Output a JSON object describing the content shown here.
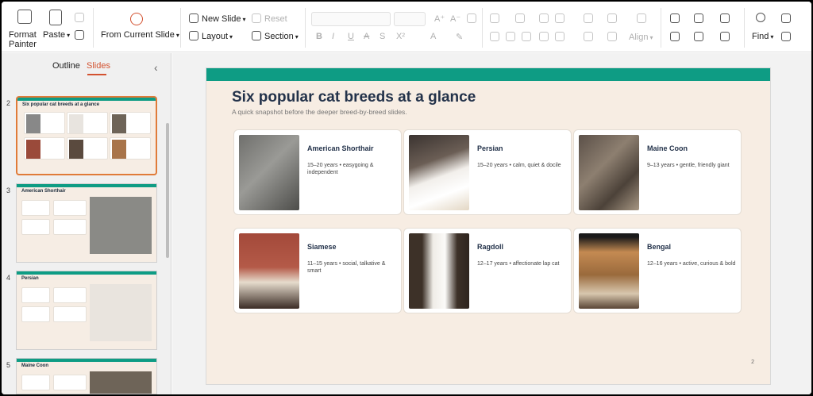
{
  "ribbon": {
    "format_painter": "Format\nPainter",
    "paste": "Paste",
    "from_current_slide": "From Current Slide",
    "new_slide": "New Slide",
    "reset": "Reset",
    "layout": "Layout",
    "section": "Section",
    "align": "Align",
    "find": "Find"
  },
  "panel": {
    "tabs": [
      "Outline",
      "Slides"
    ],
    "active_tab": "Slides",
    "thumbnails": [
      {
        "number": "2",
        "title": "Six popular cat breeds at a glance"
      },
      {
        "number": "3",
        "title": "American Shorthair"
      },
      {
        "number": "4",
        "title": "Persian"
      },
      {
        "number": "5",
        "title": "Maine Coon"
      }
    ]
  },
  "slide": {
    "title": "Six popular cat breeds at a glance",
    "subtitle": "A quick snapshot before the deeper breed-by-breed slides.",
    "page_number": "2",
    "cards": [
      {
        "name": "American Shorthair",
        "desc": "15–20 years • easygoing & independent"
      },
      {
        "name": "Persian",
        "desc": "15–20 years • calm, quiet & docile"
      },
      {
        "name": "Maine Coon",
        "desc": "9–13 years • gentle, friendly giant"
      },
      {
        "name": "Siamese",
        "desc": "11–15 years • social, talkative & smart"
      },
      {
        "name": "Ragdoll",
        "desc": "12–17 years • affectionate lap cat"
      },
      {
        "name": "Bengal",
        "desc": "12–16 years • active, curious & bold"
      }
    ]
  },
  "colors": {
    "accent": "#d35230",
    "teal": "#0e9c84",
    "slide_bg": "#f7ede3",
    "title": "#23324a"
  }
}
